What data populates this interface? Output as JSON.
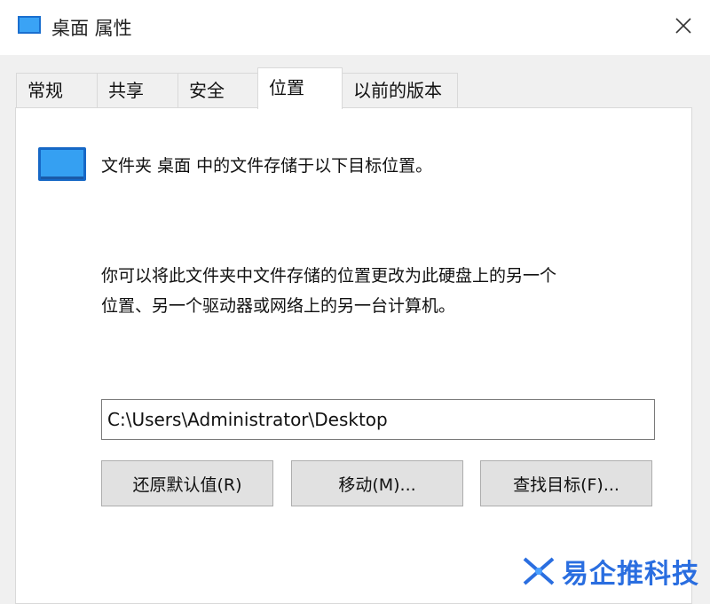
{
  "window": {
    "title": "桌面 属性",
    "icon": "desktop-folder-icon",
    "close_icon": "close-icon"
  },
  "tabs": [
    {
      "label": "常规",
      "active": false
    },
    {
      "label": "共享",
      "active": false
    },
    {
      "label": "安全",
      "active": false
    },
    {
      "label": "位置",
      "active": true
    },
    {
      "label": "以前的版本",
      "active": false
    }
  ],
  "location": {
    "heading": "文件夹 桌面 中的文件存储于以下目标位置。",
    "description_line1": "你可以将此文件夹中文件存储的位置更改为此硬盘上的另一个",
    "description_line2": "位置、另一个驱动器或网络上的另一台计算机。",
    "path_value": "C:\\Users\\Administrator\\Desktop",
    "buttons": {
      "restore": "还原默认值(R)",
      "move": "移动(M)...",
      "find_target": "查找目标(F)..."
    }
  },
  "watermark": {
    "text": "易企推科技",
    "color": "#2a6ee0"
  },
  "colors": {
    "accent": "#2a8ff0",
    "window_bg": "#f0f0f0",
    "panel_bg": "#ffffff"
  }
}
